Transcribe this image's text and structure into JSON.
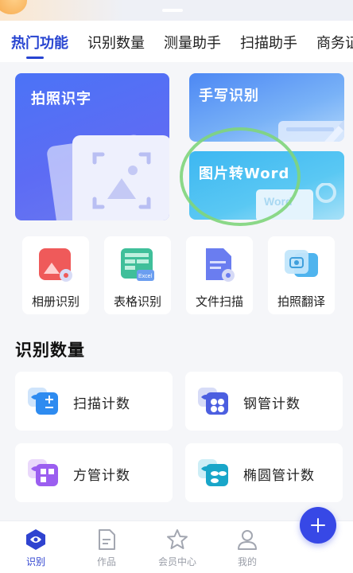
{
  "tabs": [
    {
      "label": "热门功能",
      "active": true
    },
    {
      "label": "识别数量",
      "active": false
    },
    {
      "label": "测量助手",
      "active": false
    },
    {
      "label": "扫描助手",
      "active": false
    },
    {
      "label": "商务证"
    }
  ],
  "feature_cards": {
    "photo_text": {
      "title": "拍照识字",
      "icon": "image-scan-icon"
    },
    "handwriting": {
      "title": "手写识别",
      "icon": "brush-icon"
    },
    "image_to_word": {
      "title": "图片转Word",
      "icon": "convert-icon",
      "card_text": "Word"
    }
  },
  "tools": [
    {
      "label": "相册识别",
      "icon": "album-icon"
    },
    {
      "label": "表格识别",
      "icon": "excel-table-icon",
      "icon_text": "Excel"
    },
    {
      "label": "文件扫描",
      "icon": "document-scan-icon"
    },
    {
      "label": "拍照翻译",
      "icon": "camera-translate-icon"
    }
  ],
  "count_section": {
    "title": "识别数量",
    "items": [
      {
        "label": "扫描计数",
        "icon": "scan-count-icon"
      },
      {
        "label": "钢管计数",
        "icon": "steel-pipe-icon"
      },
      {
        "label": "方管计数",
        "icon": "square-pipe-icon"
      },
      {
        "label": "椭圆管计数",
        "icon": "oval-pipe-icon"
      }
    ]
  },
  "fab": {
    "icon": "plus-icon"
  },
  "bottom_nav": [
    {
      "label": "识别",
      "icon": "eye-icon",
      "active": true
    },
    {
      "label": "作品",
      "icon": "document-icon",
      "active": false
    },
    {
      "label": "会员中心",
      "icon": "star-icon",
      "active": false
    },
    {
      "label": "我的",
      "icon": "user-icon",
      "active": false
    }
  ],
  "colors": {
    "accent": "#2744d1",
    "fab": "#3748e6",
    "photo_card": "#5d6cf4",
    "hand_card": "#79b2f7",
    "word_card": "#5ac8f3",
    "highlight_ring": "#7fd57b"
  }
}
